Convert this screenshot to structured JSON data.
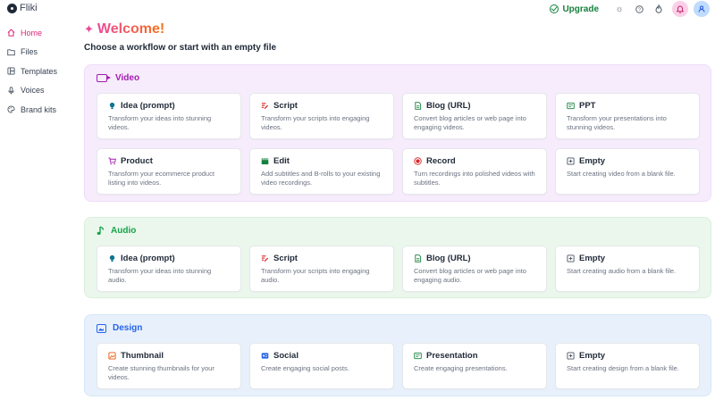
{
  "app": {
    "name": "Fliki"
  },
  "topbar": {
    "upgrade_label": "Upgrade"
  },
  "sidebar": {
    "items": [
      {
        "label": "Home",
        "icon": "home-icon"
      },
      {
        "label": "Files",
        "icon": "folder-icon"
      },
      {
        "label": "Templates",
        "icon": "templates-icon"
      },
      {
        "label": "Voices",
        "icon": "microphone-icon"
      },
      {
        "label": "Brand kits",
        "icon": "palette-icon"
      }
    ]
  },
  "main": {
    "welcome": "Welcome!",
    "subtitle": "Choose a workflow or start with an empty file"
  },
  "sections": {
    "video": {
      "title": "Video",
      "cards": [
        {
          "title": "Idea (prompt)",
          "desc": "Transform your ideas into stunning videos."
        },
        {
          "title": "Script",
          "desc": "Transform your scripts into engaging videos."
        },
        {
          "title": "Blog (URL)",
          "desc": "Convert blog articles or web page into engaging videos."
        },
        {
          "title": "PPT",
          "desc": "Transform your presentations into stunning videos."
        },
        {
          "title": "Product",
          "desc": "Transform your ecommerce product listing into videos."
        },
        {
          "title": "Edit",
          "desc": "Add subtitles and B-rolls to your existing video recordings."
        },
        {
          "title": "Record",
          "desc": "Turn recordings into polished videos with subtitles."
        },
        {
          "title": "Empty",
          "desc": "Start creating video from a blank file."
        }
      ]
    },
    "audio": {
      "title": "Audio",
      "cards": [
        {
          "title": "Idea (prompt)",
          "desc": "Transform your ideas into stunning audio."
        },
        {
          "title": "Script",
          "desc": "Transform your scripts into engaging audio."
        },
        {
          "title": "Blog (URL)",
          "desc": "Convert blog articles or web page into engaging audio."
        },
        {
          "title": "Empty",
          "desc": "Start creating audio from a blank file."
        }
      ]
    },
    "design": {
      "title": "Design",
      "cards": [
        {
          "title": "Thumbnail",
          "desc": "Create stunning thumbnails for your videos."
        },
        {
          "title": "Social",
          "desc": "Create engaging social posts."
        },
        {
          "title": "Presentation",
          "desc": "Create engaging presentations."
        },
        {
          "title": "Empty",
          "desc": "Start creating design from a blank file."
        }
      ]
    }
  },
  "colors": {
    "accent_pink": "#ec4899",
    "upgrade_green": "#15803d",
    "video_bg": "#f6ecfc",
    "audio_bg": "#ebf7ec",
    "design_bg": "#e8f1fb"
  }
}
